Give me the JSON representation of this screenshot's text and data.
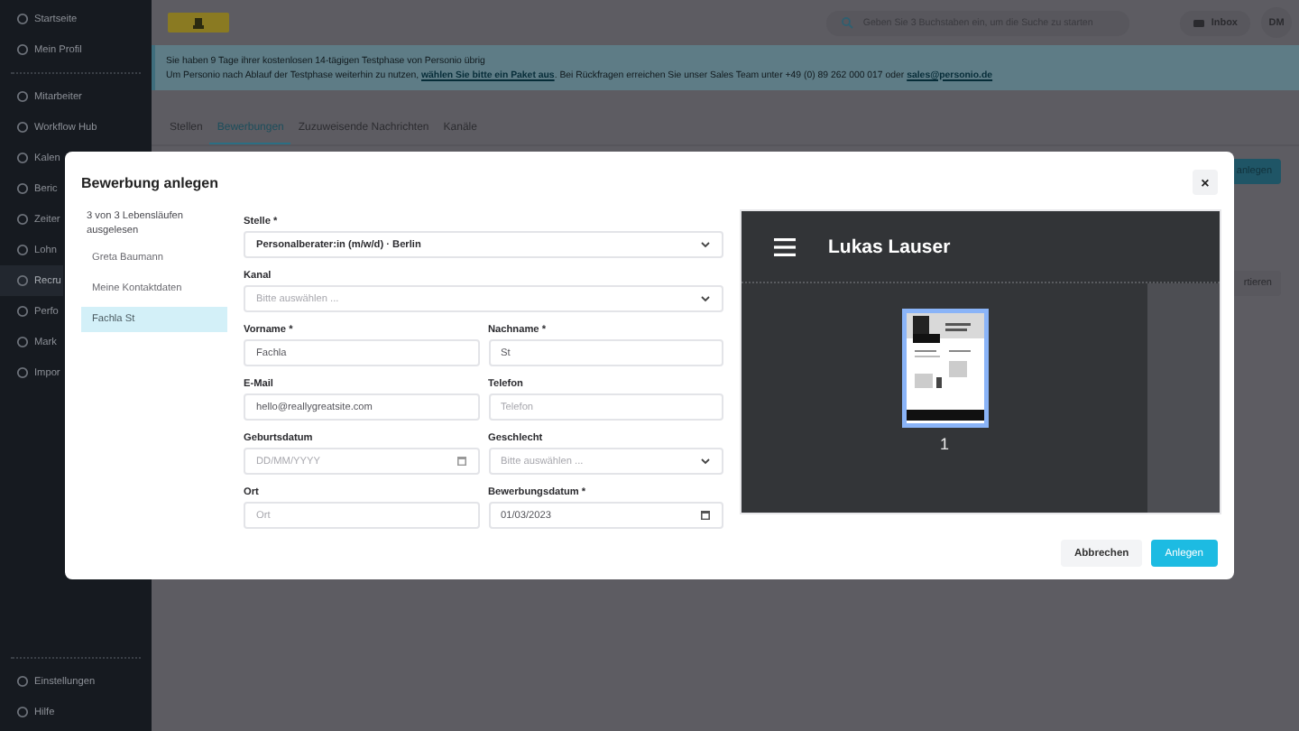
{
  "sidebar": {
    "top_items": [
      {
        "label": "Startseite",
        "selected": false
      },
      {
        "label": "Mein Profil",
        "selected": false
      }
    ],
    "items": [
      {
        "label": "Mitarbeiter",
        "selected": false
      },
      {
        "label": "Workflow Hub",
        "selected": false
      },
      {
        "label": "Kalen",
        "selected": false
      },
      {
        "label": "Beric",
        "selected": false
      },
      {
        "label": "Zeiter",
        "selected": false
      },
      {
        "label": "Lohn",
        "selected": false
      },
      {
        "label": "Recru",
        "selected": true
      },
      {
        "label": "Perfo",
        "selected": false
      },
      {
        "label": "Mark",
        "selected": false
      },
      {
        "label": "Impor",
        "selected": false
      }
    ],
    "bottom_items": [
      {
        "label": "Einstellungen",
        "selected": false
      },
      {
        "label": "Hilfe",
        "selected": false
      }
    ]
  },
  "header": {
    "search": {
      "placeholder": "Geben Sie 3 Buchstaben ein, um die Suche zu starten"
    },
    "inbox": "Inbox",
    "avatar": "DM"
  },
  "banner": {
    "line_1": "Sie haben 9 Tage ihrer kostenlosen 14-tägigen Testphase von Personio übrig",
    "line_2_start": "Um Personio nach Ablauf der Testphase weiterhin zu nutzen, ",
    "line_2_link": "wählen Sie bitte ein Paket aus",
    "line_2_middle": ". Bei Rückfragen erreichen Sie unser Sales Team unter +49 (0) 89 262 000 017 oder ",
    "line_2_email": "sales@personio.de"
  },
  "tabs": [
    {
      "label": "Stellen",
      "selected": false
    },
    {
      "label": "Bewerbungen",
      "selected": true
    },
    {
      "label": "Zuzuweisende Nachrichten",
      "selected": false
    },
    {
      "label": "Kanäle",
      "selected": false
    }
  ],
  "background_buttons": [
    {
      "label": "anlegen",
      "kind": "primary"
    },
    {
      "label": "rtieren",
      "kind": "secondary"
    }
  ],
  "modal": {
    "title": "Bewerbung anlegen",
    "close": "×",
    "resumes": {
      "status": "3 von 3 Lebensläufen ausgelesen",
      "items": [
        {
          "label": "Greta Baumann",
          "selected": false
        },
        {
          "label": "Meine Kontaktdaten",
          "selected": false
        },
        {
          "label": "Fachla St",
          "selected": true
        }
      ]
    },
    "form_rows": [
      [
        {
          "kind": "select",
          "label": "Stelle *",
          "value": "Personalberater:in (m/w/d) · Berlin"
        }
      ],
      [
        {
          "kind": "select",
          "label": "Kanal",
          "placeholder": "Bitte auswählen ..."
        }
      ],
      [
        {
          "kind": "text",
          "label": "Vorname *",
          "value": "Fachla"
        },
        {
          "kind": "text",
          "label": "Nachname *",
          "value": "St"
        }
      ],
      [
        {
          "kind": "text",
          "label": "E-Mail",
          "value": "hello@reallygreatsite.com"
        },
        {
          "kind": "text",
          "label": "Telefon",
          "placeholder": "Telefon"
        }
      ],
      [
        {
          "kind": "date",
          "label": "Geburtsdatum",
          "placeholder": "DD/MM/YYYY"
        },
        {
          "kind": "select",
          "label": "Geschlecht",
          "placeholder": "Bitte auswählen ..."
        }
      ],
      [
        {
          "kind": "text",
          "label": "Ort",
          "placeholder": "Ort"
        },
        {
          "kind": "date",
          "label": "Bewerbungsdatum *",
          "value": "01/03/2023"
        }
      ]
    ],
    "preview": {
      "title": "Lukas Lauser",
      "page_number": "1"
    },
    "buttons": [
      {
        "label": "Abbrechen",
        "kind": "secondary"
      },
      {
        "label": "Anlegen",
        "kind": "primary"
      }
    ]
  }
}
